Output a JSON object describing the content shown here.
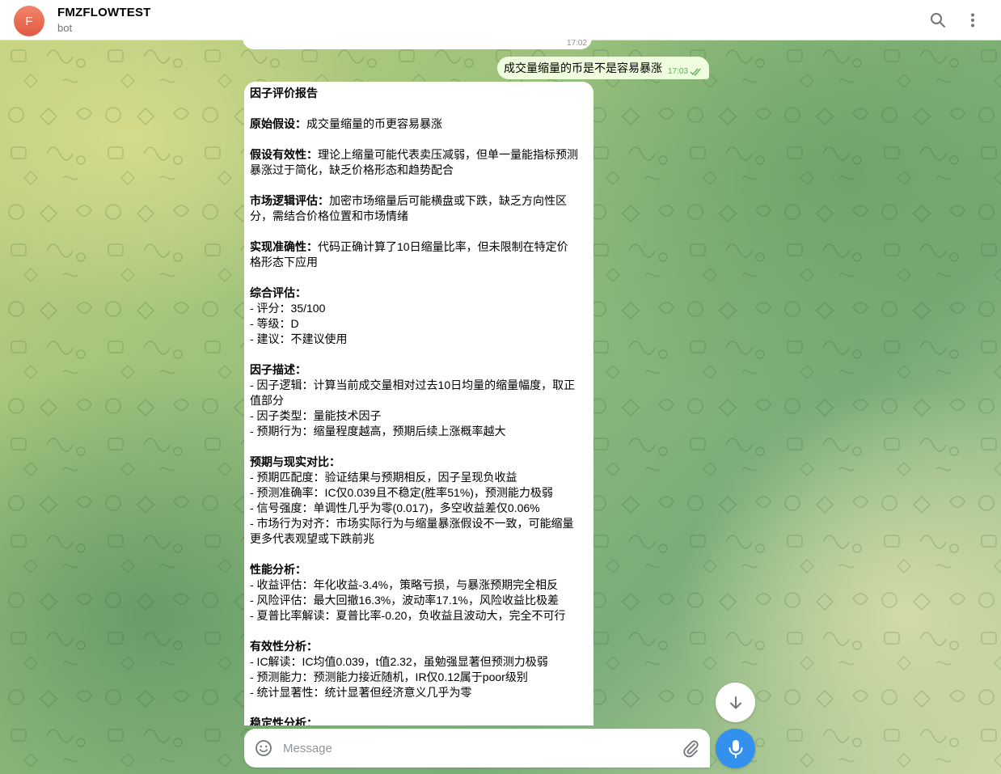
{
  "header": {
    "avatar_letter": "F",
    "title": "FMZFLOWTEST",
    "subtitle": "bot",
    "icons": [
      "search-icon",
      "more-vertical-icon"
    ]
  },
  "messages": {
    "previous_time": "17:02",
    "outgoing": {
      "text": "成交量缩量的币是不是容易暴涨",
      "time": "17:03",
      "status_icon": "double-check-icon"
    },
    "report": {
      "title": "因子评价报告",
      "hypothesis_label": "原始假设：",
      "hypothesis": "成交量缩量的币更容易暴涨",
      "validity_label": "假设有效性：",
      "validity_1": "理论上缩量可能代表卖压减弱，但单一量能指标预测",
      "validity_2": "暴涨过于简化，缺乏价格形态和趋势配合",
      "logic_label": "市场逻辑评估：",
      "logic_1": "加密市场缩量后可能横盘或下跌，缺乏方向性区",
      "logic_2": "分，需结合价格位置和市场情绪",
      "impl_label": "实现准确性：",
      "impl_1": "代码正确计算了10日缩量比率，但未限制在特定价",
      "impl_2": "格形态下应用",
      "overall_label": "综合评估：",
      "overall_score": "- 评分：35/100",
      "overall_grade": "- 等级：D",
      "overall_advice": "- 建议：不建议使用",
      "desc_label": "因子描述：",
      "desc_logic_1": "- 因子逻辑：计算当前成交量相对过去10日均量的缩量幅度，取正",
      "desc_logic_2": "值部分",
      "desc_type": "- 因子类型：量能技术因子",
      "desc_expect": "- 预期行为：缩量程度越高，预期后续上涨概率越大",
      "compare_label": "预期与现实对比：",
      "compare_match": "- 预期匹配度：验证结果与预期相反，因子呈现负收益",
      "compare_acc": "- 预测准确率：IC仅0.039且不稳定(胜率51%)，预测能力极弱",
      "compare_signal": "- 信号强度：单调性几乎为零(0.017)，多空收益差仅0.06%",
      "compare_market_1": "- 市场行为对齐：市场实际行为与缩量暴涨假设不一致，可能缩量",
      "compare_market_2": "更多代表观望或下跌前兆",
      "perf_label": "性能分析：",
      "perf_return": "- 收益评估：年化收益-3.4%，策略亏损，与暴涨预期完全相反",
      "perf_risk": "- 风险评估：最大回撤16.3%，波动率17.1%，风险收益比极差",
      "perf_sharpe": "- 夏普比率解读：夏普比率-0.20，负收益且波动大，完全不可行",
      "eff_label": "有效性分析：",
      "eff_ic": "- IC解读：IC均值0.039，t值2.32，虽勉强显著但预测力极弱",
      "eff_pred": "- 预测能力：预测能力接近随机，IR仅0.12属于poor级别",
      "eff_stat": "- 统计显著性：统计显著但经济意义几乎为零",
      "stability_label": "稳定性分析："
    }
  },
  "composer": {
    "placeholder": "Message",
    "icons": [
      "emoji-icon",
      "attach-icon",
      "microphone-icon"
    ]
  },
  "scroll_button_icon": "arrow-down-icon",
  "colors": {
    "accent": "#3390ec",
    "outgoing_bubble": "#effdde",
    "incoming_bubble": "#ffffff",
    "avatar": "#e8654f"
  }
}
